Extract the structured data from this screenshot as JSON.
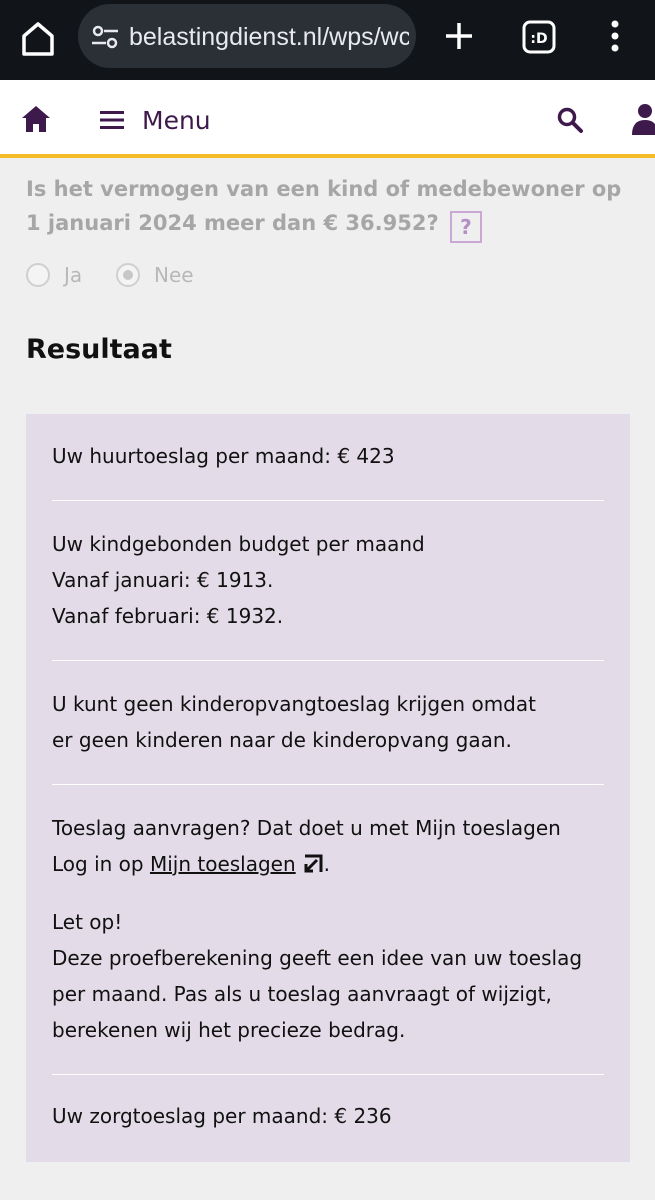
{
  "browser": {
    "url": "belastingdienst.nl/wps/wcm/connect/nl/toeslagen",
    "tabs_label": ":D"
  },
  "header": {
    "menu_label": "Menu"
  },
  "question": {
    "text": "Is het vermogen van een kind of medebewoner op 1 januari 2024 meer dan € 36.952?",
    "help": "?",
    "options": [
      "Ja",
      "Nee"
    ],
    "selected": "Nee"
  },
  "result": {
    "title": "Resultaat",
    "huurtoeslag": "Uw huurtoeslag per maand: € 423",
    "kgb_title": "Uw kindgebonden budget per maand",
    "kgb_jan": "Vanaf januari: € 1913.",
    "kgb_feb": "Vanaf februari: € 1932.",
    "kot_line1": "U kunt geen kinderopvangtoeslag krijgen omdat",
    "kot_line2": "er geen kinderen naar de kinderopvang gaan.",
    "apply_title": "Toeslag aanvragen? Dat doet u met Mijn toeslagen",
    "apply_prefix": "Log in op ",
    "apply_link": "Mijn toeslagen",
    "apply_suffix": ".",
    "note_title": "Let op!",
    "note_line1": "Deze proefberekening geeft een idee van uw toeslag",
    "note_line2": "per maand. Pas als u toeslag aanvraagt of wijzigt,",
    "note_line3": "berekenen wij het precieze bedrag.",
    "zorgtoeslag": "Uw zorgtoeslag per maand: € 236"
  },
  "colors": {
    "brand_purple": "#3d1a4b",
    "header_border": "#f6bb29",
    "result_bg": "#e3dce8",
    "browser_bar": "#111418"
  }
}
